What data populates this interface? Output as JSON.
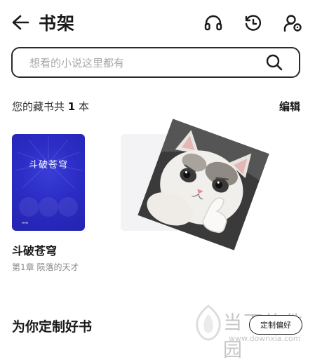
{
  "header": {
    "title": "书架",
    "back_icon": "arrow-left-icon",
    "icons": [
      "headphones-icon",
      "history-clock-icon",
      "profile-settings-icon"
    ]
  },
  "search": {
    "placeholder": "想看的小说这里都有",
    "icon": "search-icon"
  },
  "shelf": {
    "count_prefix": "您的藏书共",
    "count": "1",
    "count_unit": "本",
    "edit_label": "编辑"
  },
  "book": {
    "cover_title": "斗破苍穹",
    "name": "斗破苍穹",
    "chapter": "第1章 陨落的天才",
    "cover_color": "#2a2cc4"
  },
  "recommend": {
    "title": "为你定制好书",
    "preference_button": "定制偏好"
  },
  "watermark": {
    "text": "当下软件园",
    "url": "www.downxia.com"
  }
}
